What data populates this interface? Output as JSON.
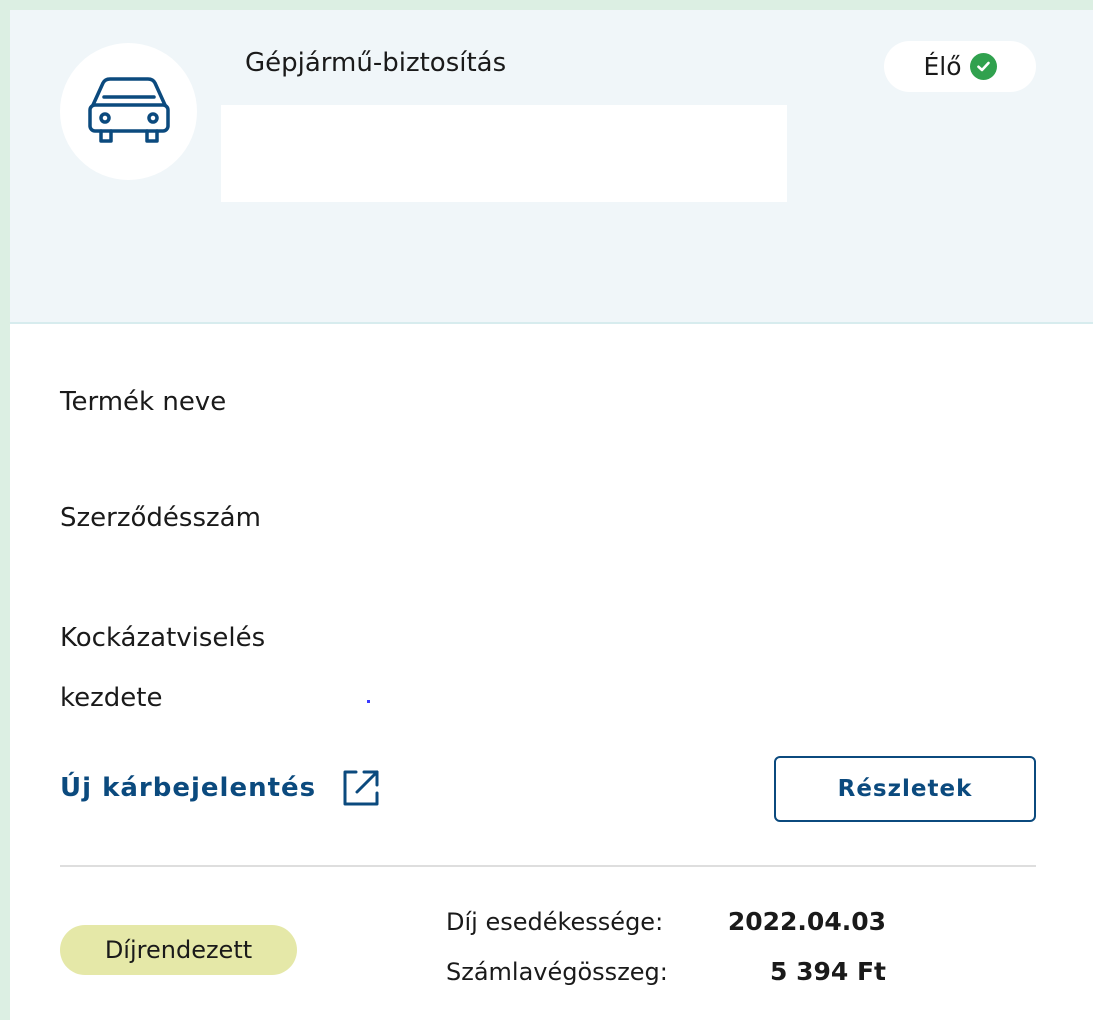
{
  "policy": {
    "type": "Gépjármű-biztosítás",
    "icon": "car-icon",
    "status": {
      "label": "Élő",
      "icon": "check-circle-icon",
      "color": "#30a14e"
    }
  },
  "fields": [
    {
      "label": "Termék neve"
    },
    {
      "label": "Szerződésszám"
    },
    {
      "label": "Kockázatviselés kezdete"
    }
  ],
  "actions": {
    "claim_link": "Új kárbejelentés",
    "claim_icon": "external-link-icon",
    "details_button": "Részletek"
  },
  "billing": {
    "badge": "Díjrendezett",
    "due_label": "Díj esedékessége:",
    "due_value": "2022.04.03",
    "amount_label": "Számlavégösszeg:",
    "amount_value": "5 394 Ft"
  },
  "colors": {
    "accent": "#0b4a7e",
    "header_bg": "#f0f6f9",
    "page_bg": "#dcefe3",
    "badge_bg": "#e5e8a8"
  }
}
